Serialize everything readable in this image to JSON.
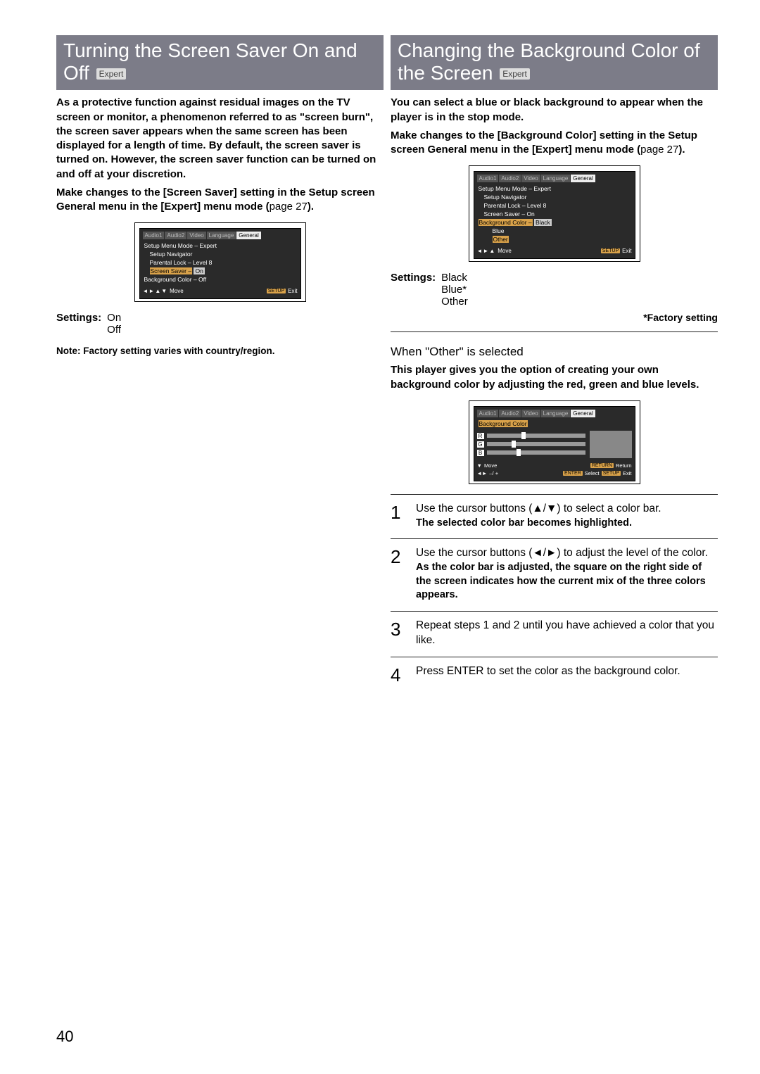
{
  "page_number": "40",
  "left": {
    "title_main": "Turning the Screen Saver On and Off",
    "title_badge": "Expert",
    "para1": "As a protective function against residual images on the TV screen or monitor, a phenomenon referred to as \"screen burn\", the screen saver appears when the same screen has been displayed for a length of time. By default, the screen saver is turned on. However, the screen saver function can be turned on and off at your discretion.",
    "para2_pre": "Make changes to the ",
    "para2_opt": "[Screen Saver]",
    "para2_mid": " setting in the Setup screen ",
    "para2_menu": "General",
    "para2_mid2": " menu in the ",
    "para2_mode": "[Expert]",
    "para2_end": " menu mode (",
    "para2_page": "page 27",
    "para2_close": ").",
    "osd": {
      "tabs": [
        "Audio1",
        "Audio2",
        "Video",
        "Language",
        "General"
      ],
      "active_tab": 4,
      "lines": [
        {
          "text": "Setup Menu Mode – Expert",
          "indent": 0
        },
        {
          "text": "Setup Navigator",
          "indent": 1
        },
        {
          "text": "Parental Lock – Level 8",
          "indent": 1
        },
        {
          "hl_left": "Screen Saver –",
          "hl_right": "On",
          "indent": 1,
          "highlight": true
        },
        {
          "text": "Background Color – Off",
          "indent": 0
        }
      ],
      "footer_move": "Move",
      "footer_btn": "SETUP",
      "footer_exit": "Exit"
    },
    "settings_label": "Settings:",
    "settings_values": [
      "On",
      "Off"
    ],
    "note": "Note: Factory setting varies with country/region."
  },
  "right": {
    "title_main": "Changing the Background Color of the Screen",
    "title_badge": "Expert",
    "para1": "You can select a blue or black background to appear when the player is in the stop mode.",
    "para2_pre": "Make changes to the ",
    "para2_opt": "[Background Color]",
    "para2_mid": " setting in the Setup screen ",
    "para2_menu": "General",
    "para2_mid2": " menu in the ",
    "para2_mode": "[Expert]",
    "para2_end": " menu mode (",
    "para2_page": "page 27",
    "para2_close": ").",
    "osd": {
      "tabs": [
        "Audio1",
        "Audio2",
        "Video",
        "Language",
        "General"
      ],
      "active_tab": 4,
      "lines": [
        {
          "text": "Setup Menu Mode – Expert",
          "indent": 0
        },
        {
          "text": "Setup Navigator",
          "indent": 1
        },
        {
          "text": "Parental Lock – Level 8",
          "indent": 1
        },
        {
          "text": "Screen Saver – On",
          "indent": 1
        },
        {
          "hl_left": "Background Color –",
          "hl_right": "Black",
          "indent": 0,
          "highlight": true
        },
        {
          "text": "Blue",
          "indent": 2,
          "option": true
        },
        {
          "hl_right": "Other",
          "indent": 2,
          "highlight_right_only": true
        }
      ],
      "footer_move": "Move",
      "footer_btn": "SETUP",
      "footer_exit": "Exit"
    },
    "settings_label": "Settings:",
    "settings_values": [
      "Black",
      "Blue*",
      "Other"
    ],
    "factory": "*Factory setting",
    "when_other": "When \"Other\" is selected",
    "when_other_text": "This player gives you the option of creating your own background color by adjusting the red, green and blue levels.",
    "osd2": {
      "tabs": [
        "Audio1",
        "Audio2",
        "Video",
        "Language",
        "General"
      ],
      "active_tab": 4,
      "title": "Background Color",
      "sliders": [
        "R",
        "G",
        "B"
      ],
      "footer_move": "Move",
      "footer_return_btn": "RETURN",
      "footer_return": "Return",
      "footer_adjust": "–/ +",
      "footer_enter_btn": "ENTER",
      "footer_select": "Select",
      "footer_setup_btn": "SETUP",
      "footer_exit": "Exit"
    },
    "steps": [
      {
        "num": "1",
        "text": "Use the cursor buttons (▲/▼) to select a color bar.",
        "strong": "The selected color bar becomes highlighted."
      },
      {
        "num": "2",
        "text": "Use the cursor buttons (◄/►) to adjust the level of the color.",
        "strong": "As the color bar is adjusted, the square on the right side of the screen indicates how the current mix of the three colors appears."
      },
      {
        "num": "3",
        "text": "Repeat steps 1 and 2 until you have achieved a color that you like.",
        "strong": ""
      },
      {
        "num": "4",
        "text": "Press ENTER to set the color as the background color.",
        "strong": ""
      }
    ]
  }
}
